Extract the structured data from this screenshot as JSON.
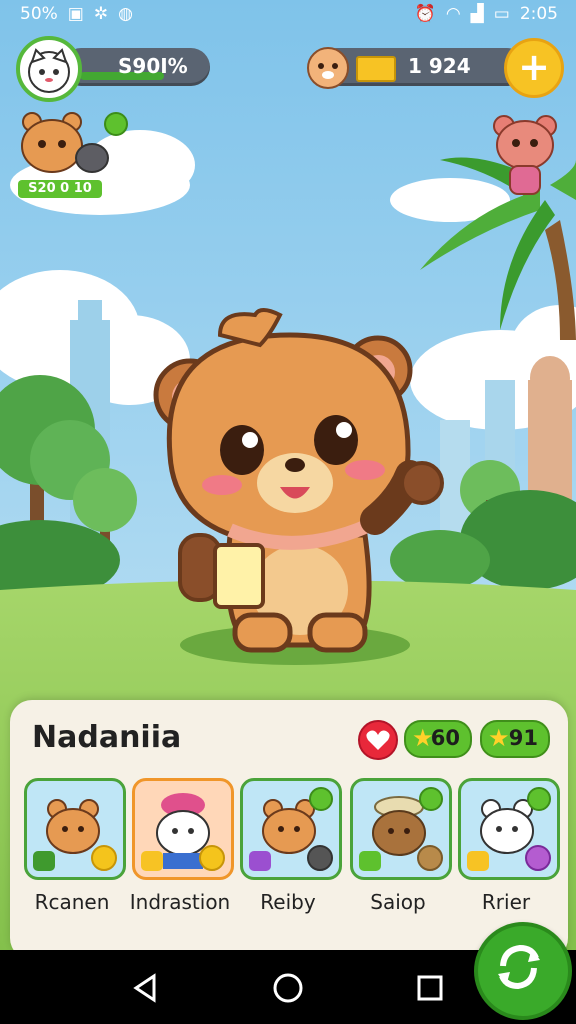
{
  "status_bar": {
    "left_text": "50%",
    "time": "2:05",
    "icons": [
      "image-icon",
      "settings-icon",
      "clock-icon",
      "wifi-icon",
      "signal-icon",
      "battery-icon"
    ]
  },
  "hud": {
    "profile_value": "S90I%",
    "gold_value": "1 924",
    "plus_label": "+",
    "secondary_badge": "S20 0 10"
  },
  "panel": {
    "title": "Nadaniia",
    "stars_1": "60",
    "stars_2": "91",
    "characters": [
      {
        "name": "Rcanen",
        "selected": false
      },
      {
        "name": "Indrastion",
        "selected": true
      },
      {
        "name": "Reiby",
        "selected": false
      },
      {
        "name": "Saiop",
        "selected": false
      },
      {
        "name": "Rrier",
        "selected": false
      }
    ]
  },
  "colors": {
    "accent_green": "#5ec12e",
    "gold": "#f7c324",
    "panel_bg": "#f6f1e6",
    "heart_red": "#e8283a"
  },
  "nav": {
    "icons": [
      "back-icon",
      "home-icon",
      "recents-icon"
    ]
  }
}
